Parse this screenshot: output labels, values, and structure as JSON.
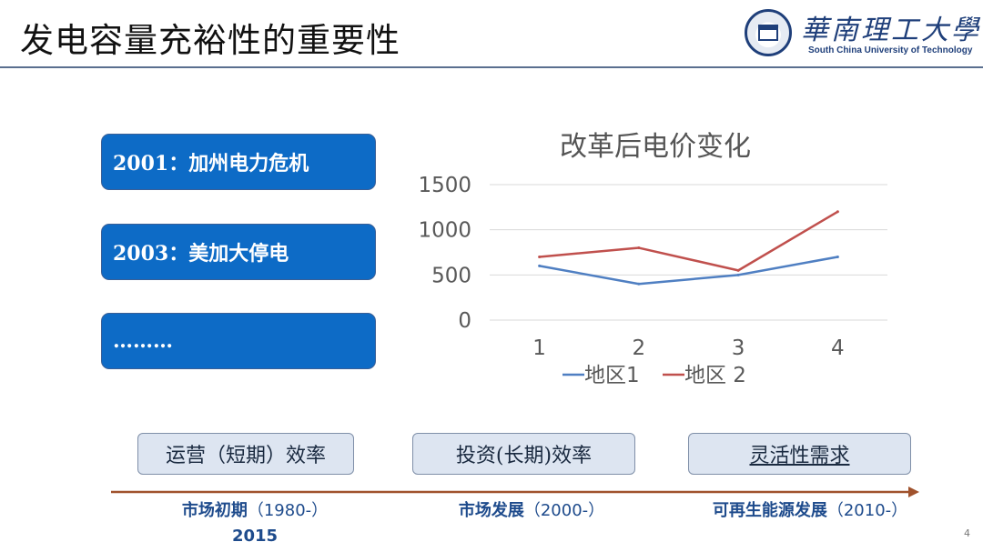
{
  "slide": {
    "title": "发电容量充裕性的重要性",
    "page_number": "4"
  },
  "logo": {
    "name_cn": "華南理工大學",
    "name_en": "South China University of Technology"
  },
  "events": [
    {
      "label": "2001：加州电力危机"
    },
    {
      "label": "2003：美加大停电"
    },
    {
      "label": "………"
    }
  ],
  "chart_data": {
    "type": "line",
    "title": "改革后电价变化",
    "x": [
      1,
      2,
      3,
      4
    ],
    "categories": [
      "1",
      "2",
      "3",
      "4"
    ],
    "series": [
      {
        "name": "地区1",
        "values": [
          600,
          400,
          500,
          700
        ],
        "color": "#4f7fc2"
      },
      {
        "name": "地区 2",
        "values": [
          700,
          800,
          550,
          1200
        ],
        "color": "#c0504d"
      }
    ],
    "ylim": [
      0,
      1500
    ],
    "yticks": [
      0,
      500,
      1000,
      1500
    ],
    "grid": true,
    "legend": "bottom"
  },
  "stages": [
    {
      "label": "运营（短期）效率"
    },
    {
      "label": "投资(长期)效率"
    },
    {
      "label": "灵活性需求"
    }
  ],
  "timeline": {
    "color": "#a0522d",
    "eras": [
      {
        "name": "市场初期",
        "range": "（1980-）",
        "line2": "2015"
      },
      {
        "name": "市场发展",
        "range": "（2000-）"
      },
      {
        "name": "可再生能源发展",
        "range": "（2010-）"
      }
    ]
  }
}
